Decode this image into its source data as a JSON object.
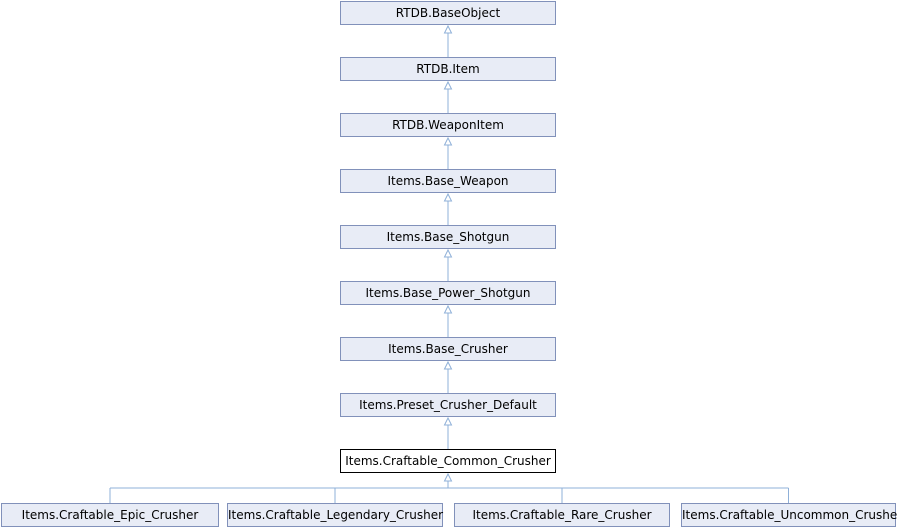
{
  "diagram": {
    "nodes": [
      {
        "id": "n0",
        "label": "RTDB.BaseObject",
        "current": false
      },
      {
        "id": "n1",
        "label": "RTDB.Item",
        "current": false
      },
      {
        "id": "n2",
        "label": "RTDB.WeaponItem",
        "current": false
      },
      {
        "id": "n3",
        "label": "Items.Base_Weapon",
        "current": false
      },
      {
        "id": "n4",
        "label": "Items.Base_Shotgun",
        "current": false
      },
      {
        "id": "n5",
        "label": "Items.Base_Power_Shotgun",
        "current": false
      },
      {
        "id": "n6",
        "label": "Items.Base_Crusher",
        "current": false
      },
      {
        "id": "n7",
        "label": "Items.Preset_Crusher_Default",
        "current": false
      },
      {
        "id": "n8",
        "label": "Items.Craftable_Common_Crusher",
        "current": true
      },
      {
        "id": "n9",
        "label": "Items.Craftable_Epic_Crusher",
        "current": false
      },
      {
        "id": "n10",
        "label": "Items.Craftable_Legendary_Crusher",
        "current": false
      },
      {
        "id": "n11",
        "label": "Items.Craftable_Rare_Crusher",
        "current": false
      },
      {
        "id": "n12",
        "label": "Items.Craftable_Uncommon_Crusher",
        "current": false
      }
    ],
    "edges": [
      {
        "from": "n1",
        "to": "n0"
      },
      {
        "from": "n2",
        "to": "n1"
      },
      {
        "from": "n3",
        "to": "n2"
      },
      {
        "from": "n4",
        "to": "n3"
      },
      {
        "from": "n5",
        "to": "n4"
      },
      {
        "from": "n6",
        "to": "n5"
      },
      {
        "from": "n7",
        "to": "n6"
      },
      {
        "from": "n8",
        "to": "n7"
      },
      {
        "from": "n9",
        "to": "n8"
      },
      {
        "from": "n10",
        "to": "n8"
      },
      {
        "from": "n11",
        "to": "n8"
      },
      {
        "from": "n12",
        "to": "n8"
      }
    ],
    "colors": {
      "node_fill": "#e8ecf6",
      "node_border": "#8191ba",
      "current_fill": "#ffffff",
      "current_border": "#000000",
      "edge": "#8fb0d8"
    }
  }
}
